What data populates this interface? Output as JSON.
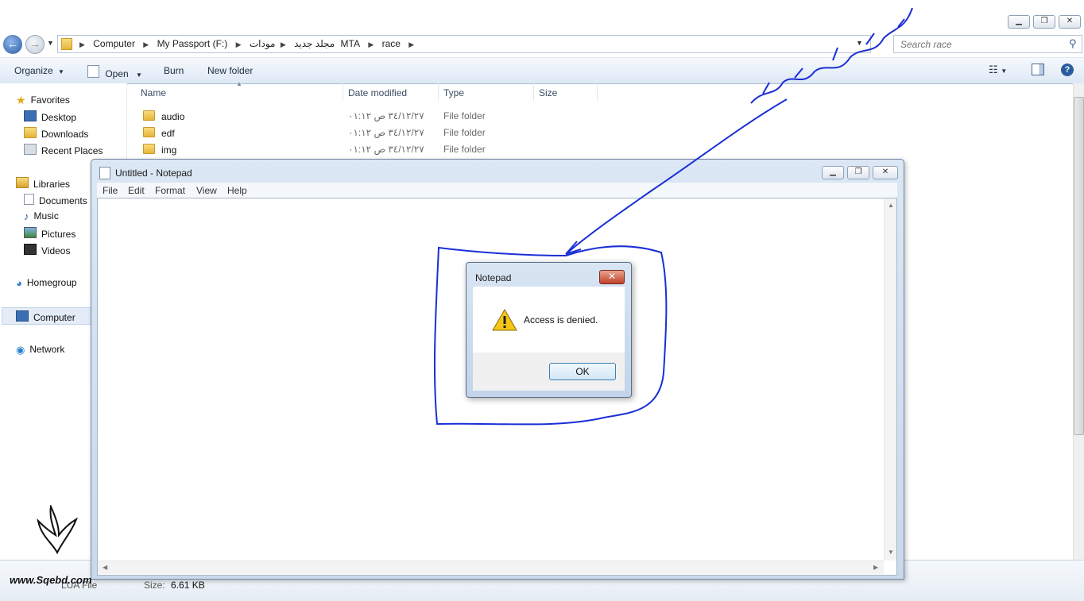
{
  "explorer": {
    "breadcrumb": [
      "Computer",
      "My Passport (F:)",
      "مجلد جديد",
      "مودات MTA",
      "race"
    ],
    "search_placeholder": "Search race",
    "toolbar": {
      "organize": "Organize",
      "open": "Open",
      "burn": "Burn",
      "new_folder": "New folder"
    },
    "nav": {
      "favorites": "Favorites",
      "desktop": "Desktop",
      "downloads": "Downloads",
      "recent_places": "Recent Places",
      "libraries": "Libraries",
      "documents": "Documents",
      "music": "Music",
      "pictures": "Pictures",
      "videos": "Videos",
      "homegroup": "Homegroup",
      "computer": "Computer",
      "network": "Network"
    },
    "columns": {
      "name": "Name",
      "date_modified": "Date modified",
      "type": "Type",
      "size": "Size"
    },
    "files": [
      {
        "name": "audio",
        "date": "٣٤/١٢/٢٧ ص ٠١:١٢",
        "type": "File folder"
      },
      {
        "name": "edf",
        "date": "٣٤/١٢/٢٧ ص ٠١:١٢",
        "type": "File folder"
      },
      {
        "name": "img",
        "date": "٣٤/١٢/٢٧ ص ٠١:١٢",
        "type": "File folder"
      }
    ],
    "details": {
      "type": "LUA File",
      "size_label": "Size:",
      "size_value": "6.61 KB"
    }
  },
  "notepad": {
    "title": "Untitled - Notepad",
    "menu": [
      "File",
      "Edit",
      "Format",
      "View",
      "Help"
    ]
  },
  "dialog": {
    "title": "Notepad",
    "message": "Access is denied.",
    "ok_label": "OK"
  },
  "watermark": {
    "site": "www.Sqebd.com"
  },
  "accent_colors": {
    "annotation_ink": "#1a2fd6",
    "selection": "#e4ecf7",
    "close_button": "#c2412b"
  }
}
